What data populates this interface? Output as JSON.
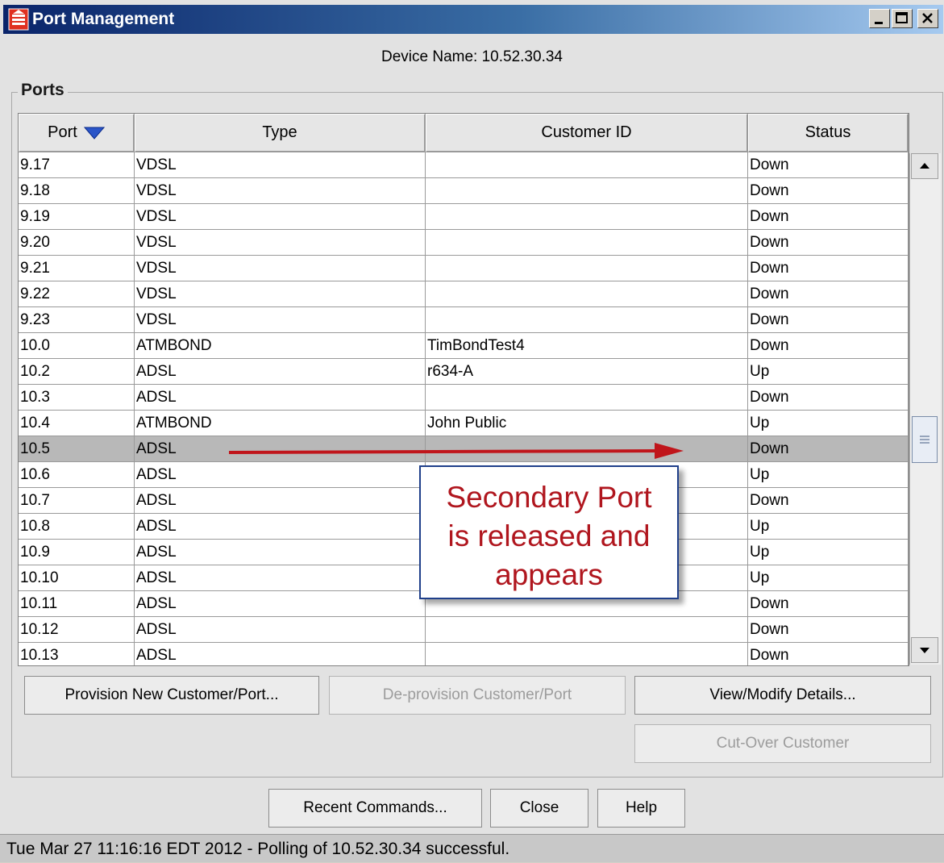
{
  "window": {
    "title": "Port Management"
  },
  "device_label": "Device Name:  10.52.30.34",
  "ports_label": "Ports",
  "columns": [
    "Port",
    "Type",
    "Customer ID",
    "Status"
  ],
  "rows": [
    {
      "port": "9.17",
      "type": "VDSL",
      "customer": "",
      "status": "Down"
    },
    {
      "port": "9.18",
      "type": "VDSL",
      "customer": "",
      "status": "Down"
    },
    {
      "port": "9.19",
      "type": "VDSL",
      "customer": "",
      "status": "Down"
    },
    {
      "port": "9.20",
      "type": "VDSL",
      "customer": "",
      "status": "Down"
    },
    {
      "port": "9.21",
      "type": "VDSL",
      "customer": "",
      "status": "Down"
    },
    {
      "port": "9.22",
      "type": "VDSL",
      "customer": "",
      "status": "Down"
    },
    {
      "port": "9.23",
      "type": "VDSL",
      "customer": "",
      "status": "Down"
    },
    {
      "port": "10.0",
      "type": "ATMBOND",
      "customer": "TimBondTest4",
      "status": "Down"
    },
    {
      "port": "10.2",
      "type": "ADSL",
      "customer": "r634-A",
      "status": "Up"
    },
    {
      "port": "10.3",
      "type": "ADSL",
      "customer": "",
      "status": "Down"
    },
    {
      "port": "10.4",
      "type": "ATMBOND",
      "customer": "John Public",
      "status": "Up"
    },
    {
      "port": "10.5",
      "type": "ADSL",
      "customer": "",
      "status": "Down",
      "selected": true
    },
    {
      "port": "10.6",
      "type": "ADSL",
      "customer": "",
      "status": "Up"
    },
    {
      "port": "10.7",
      "type": "ADSL",
      "customer": "",
      "status": "Down"
    },
    {
      "port": "10.8",
      "type": "ADSL",
      "customer": "",
      "status": "Up"
    },
    {
      "port": "10.9",
      "type": "ADSL",
      "customer": "",
      "status": "Up"
    },
    {
      "port": "10.10",
      "type": "ADSL",
      "customer": "",
      "status": "Up"
    },
    {
      "port": "10.11",
      "type": "ADSL",
      "customer": "",
      "status": "Down"
    },
    {
      "port": "10.12",
      "type": "ADSL",
      "customer": "",
      "status": "Down"
    },
    {
      "port": "10.13",
      "type": "ADSL",
      "customer": "",
      "status": "Down"
    }
  ],
  "buttons": {
    "provision": "Provision New Customer/Port...",
    "deprovision": "De-provision Customer/Port",
    "view_modify": "View/Modify Details...",
    "cutover": "Cut-Over Customer",
    "recent": "Recent Commands...",
    "close": "Close",
    "help": "Help"
  },
  "callout": "Secondary Port\nis released and\nappears",
  "status_bar": "Tue Mar 27 11:16:16 EDT 2012 - Polling of 10.52.30.34 successful.",
  "colors": {
    "callout_text": "#b0161e",
    "callout_border": "#1f3f8a",
    "arrow": "#c0151b"
  }
}
